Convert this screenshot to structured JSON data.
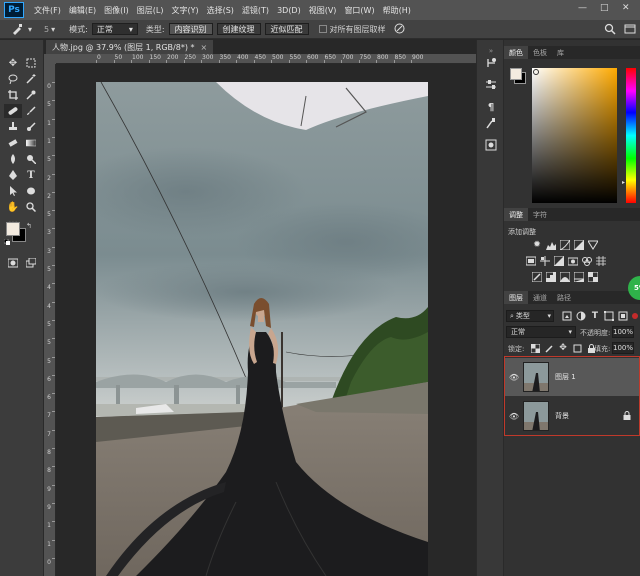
{
  "app": {
    "logo": "Ps"
  },
  "menu": [
    "文件(F)",
    "编辑(E)",
    "图像(I)",
    "图层(L)",
    "文字(Y)",
    "选择(S)",
    "滤镜(T)",
    "3D(D)",
    "视图(V)",
    "窗口(W)",
    "帮助(H)"
  ],
  "window_controls": {
    "minimize": "—",
    "restore": "□",
    "close": "✕"
  },
  "options": {
    "brush_size": "5",
    "mode_label": "模式:",
    "mode_value": "正常",
    "type_label": "类型:",
    "btn_content_aware": "内容识别",
    "btn_create_texture": "创建纹理",
    "btn_proximity_match": "近似匹配",
    "sample_all_layers": "对所有图层取样"
  },
  "document_tab": {
    "title": "人物.jpg @ 37.9% (图层 1, RGB/8*) *",
    "close": "×"
  },
  "ruler": {
    "h_labels": [
      "0",
      "50",
      "100",
      "150",
      "200",
      "250",
      "300",
      "350",
      "400",
      "450",
      "500",
      "550",
      "600",
      "650",
      "700",
      "750",
      "800",
      "850",
      "900"
    ],
    "v_labels": [
      "0",
      "5",
      "1",
      "1",
      "5",
      "2",
      "2",
      "5",
      "3",
      "3",
      "5",
      "4",
      "4",
      "5",
      "5",
      "5",
      "6",
      "6",
      "7",
      "7",
      "8",
      "8",
      "9",
      "9",
      "1",
      "1",
      "0"
    ]
  },
  "panels": {
    "color_tabs": [
      "颜色",
      "色板",
      "库"
    ],
    "adjust_tabs": [
      "调整",
      "字符"
    ],
    "adjust_title": "添加调整",
    "layer_tabs": [
      "图层",
      "通道",
      "路径"
    ],
    "filter_label": "类型",
    "blend_mode": "正常",
    "opacity_label": "不透明度:",
    "opacity_value": "100%",
    "lock_label": "锁定:",
    "fill_label": "填充:",
    "fill_value": "100%",
    "layers": [
      {
        "name": "图层 1",
        "selected": true
      },
      {
        "name": "背景",
        "selected": false,
        "locked": true
      }
    ],
    "badge": "5%"
  },
  "colors": {
    "foreground": "#f3ebe0",
    "background": "#000000",
    "accent_red": "#c0392b"
  }
}
